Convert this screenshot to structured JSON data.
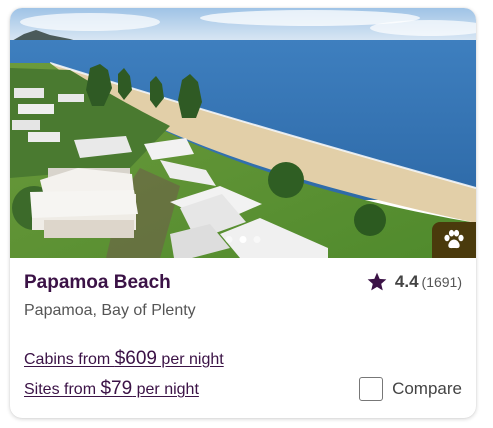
{
  "listing": {
    "name": "Papamoa Beach",
    "rating": "4.4",
    "review_count": "(1691)",
    "location": "Papamoa, Bay of Plenty",
    "cabins": {
      "prefix": "Cabins from ",
      "price": "$609",
      "suffix": " per night"
    },
    "sites": {
      "prefix": "Sites from ",
      "price": "$79",
      "suffix": " per night"
    },
    "compare_label": "Compare",
    "compare_checked": false,
    "photo_count": 3,
    "active_photo": 1,
    "pet_friendly_icon": "paw-icon",
    "rating_icon": "star-icon"
  },
  "colors": {
    "title": "#3b1246",
    "star": "#3b1246",
    "pet_badge": "#4a3a0c"
  }
}
